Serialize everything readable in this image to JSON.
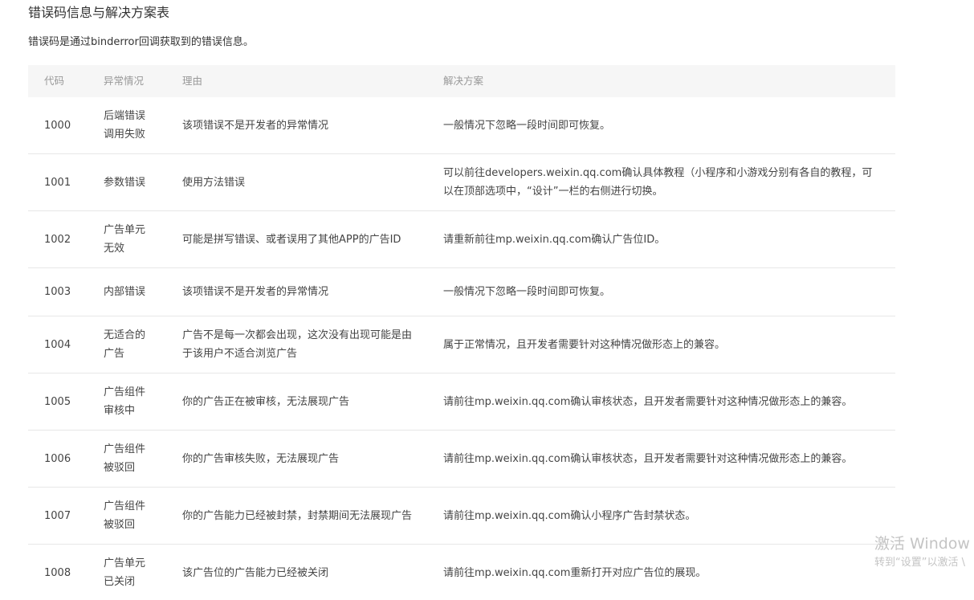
{
  "title": "错误码信息与解决方案表",
  "description": "错误码是通过binderror回调获取到的错误信息。",
  "table": {
    "headers": [
      "代码",
      "异常情况",
      "理由",
      "解决方案"
    ],
    "rows": [
      {
        "code": "1000",
        "case": "后端错误调用失败",
        "reason": "该项错误不是开发者的异常情况",
        "solution": "一般情况下忽略一段时间即可恢复。"
      },
      {
        "code": "1001",
        "case": "参数错误",
        "reason": "使用方法错误",
        "solution": "可以前往developers.weixin.qq.com确认具体教程（小程序和小游戏分别有各自的教程，可以在顶部选项中，“设计”一栏的右侧进行切换。"
      },
      {
        "code": "1002",
        "case": "广告单元无效",
        "reason": "可能是拼写错误、或者误用了其他APP的广告ID",
        "solution": "请重新前往mp.weixin.qq.com确认广告位ID。"
      },
      {
        "code": "1003",
        "case": "内部错误",
        "reason": "该项错误不是开发者的异常情况",
        "solution": "一般情况下忽略一段时间即可恢复。"
      },
      {
        "code": "1004",
        "case": "无适合的广告",
        "reason": "广告不是每一次都会出现，这次没有出现可能是由于该用户不适合浏览广告",
        "solution": "属于正常情况，且开发者需要针对这种情况做形态上的兼容。"
      },
      {
        "code": "1005",
        "case": "广告组件审核中",
        "reason": "你的广告正在被审核，无法展现广告",
        "solution": "请前往mp.weixin.qq.com确认审核状态，且开发者需要针对这种情况做形态上的兼容。"
      },
      {
        "code": "1006",
        "case": "广告组件被驳回",
        "reason": "你的广告审核失败，无法展现广告",
        "solution": "请前往mp.weixin.qq.com确认审核状态，且开发者需要针对这种情况做形态上的兼容。"
      },
      {
        "code": "1007",
        "case": "广告组件被驳回",
        "reason": "你的广告能力已经被封禁，封禁期间无法展现广告",
        "solution": "请前往mp.weixin.qq.com确认小程序广告封禁状态。"
      },
      {
        "code": "1008",
        "case": "广告单元已关闭",
        "reason": "该广告位的广告能力已经被关闭",
        "solution": "请前往mp.weixin.qq.com重新打开对应广告位的展现。"
      }
    ]
  },
  "watermark": {
    "line1": "激活 Window",
    "line2": "转到“设置”以激活 \\"
  }
}
